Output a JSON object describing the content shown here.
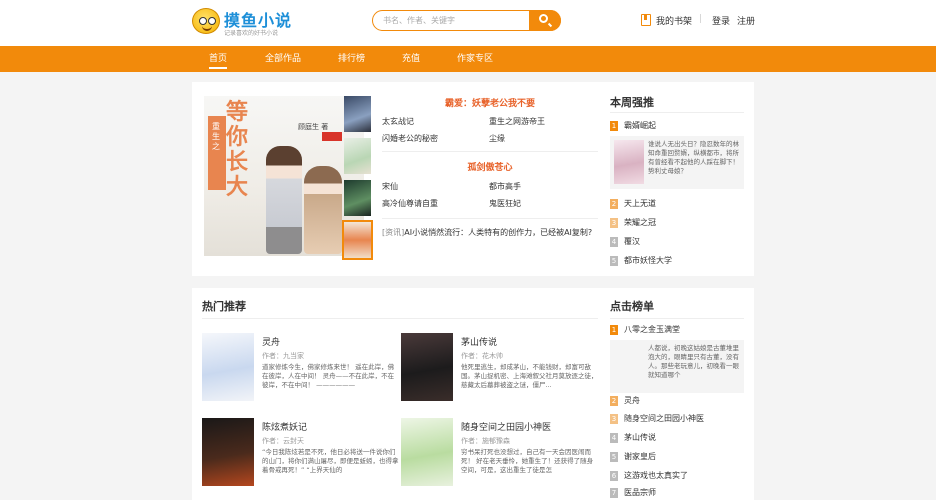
{
  "header": {
    "logo_title": "摸鱼小说",
    "logo_slogan": "记录喜欢的好书小说",
    "search_placeholder": "书名、作者、关键字",
    "bookshelf_label": "我的书架",
    "separator": "|",
    "login_label": "登录",
    "register_label": "注册"
  },
  "nav": {
    "items": [
      "首页",
      "全部作品",
      "排行榜",
      "充值",
      "作家专区"
    ],
    "active_index": 0
  },
  "featured": {
    "cover": {
      "title_small": "重生之",
      "title_big": "等你长大",
      "author": "顾庭生 著"
    },
    "group1": {
      "title": "霸爱：妖孽老公我不要",
      "items": [
        "太玄战记",
        "重生之网游帝王",
        "闪婚老公的秘密",
        "尘缘"
      ]
    },
    "group2": {
      "title": "孤剑傲苍心",
      "items": [
        "宋仙",
        "都市高手",
        "高冷仙尊请自重",
        "鬼医狂妃"
      ]
    },
    "news": {
      "tag": "[资讯]",
      "text": "AI小说悄然流行：人类特有的创作力，已经被AI复制?"
    }
  },
  "weekly": {
    "title": "本周强推",
    "top": {
      "num": "1",
      "name": "霸婿崛起",
      "desc": "谁说人无出头日？隐忍数年的林知命重回赘婿，纵横都市，将所有曾经看不起他的人踩在脚下！势利丈母娘？"
    },
    "items": [
      {
        "num": "2",
        "name": "天上无道"
      },
      {
        "num": "3",
        "name": "荣耀之冠"
      },
      {
        "num": "4",
        "name": "覆汉"
      },
      {
        "num": "5",
        "name": "都市妖怪大学"
      }
    ]
  },
  "hot": {
    "title": "热门推荐",
    "books": [
      {
        "title": "灵舟",
        "author": "作者：九当家",
        "desc": "道家修炼今生，佛家修炼来世！ 遥在此岸，佛在彼岸，人在中间！ 灵舟——不在此岸，不在彼岸，不在中间！ ——————"
      },
      {
        "title": "茅山传说",
        "author": "作者：花木帅",
        "desc": "他死里逃生，却成茅山，不能钱财，却富可敌国。茅山捉机密、上海滩叙父社月莫放逐之徒，慈藏太后墓葬被盗之谜，僵尸..."
      },
      {
        "title": "陈炫煮妖记",
        "author": "作者：云封天",
        "desc": "“今日我陈炫若是不死，他日必将送一件说你们的山门，将你们满山屠尽，即便是蚯蚓，也得拿着骨戒再死！” “上界天仙的"
      },
      {
        "title": "随身空间之田园小神医",
        "author": "作者：施郁豫森",
        "desc": "穷书呆打死也没想过，自己有一天会因医闹而死！ 好在老天垂怜，她重生了！还获得了随身空间，可是，这出重生了徒是怎"
      }
    ]
  },
  "clicks": {
    "title": "点击榜单",
    "top": {
      "num": "1",
      "name": "八零之金玉满堂",
      "desc": "人都说，初晚这姑娘是古董堆里泡大的，眼睛里只有古董，没有人。那些老玩意儿，初晚看一眼就知道哪个"
    },
    "items": [
      {
        "num": "2",
        "name": "灵舟"
      },
      {
        "num": "3",
        "name": "随身空间之田园小神医"
      },
      {
        "num": "4",
        "name": "茅山传说"
      },
      {
        "num": "5",
        "name": "谢家皇后"
      },
      {
        "num": "6",
        "name": "这游戏也太真实了"
      },
      {
        "num": "7",
        "name": "医品宗师"
      }
    ]
  },
  "colors": {
    "brand_orange": "#f28a0b",
    "featured_title": "#e8632b",
    "logo_blue": "#1d8fd8"
  }
}
